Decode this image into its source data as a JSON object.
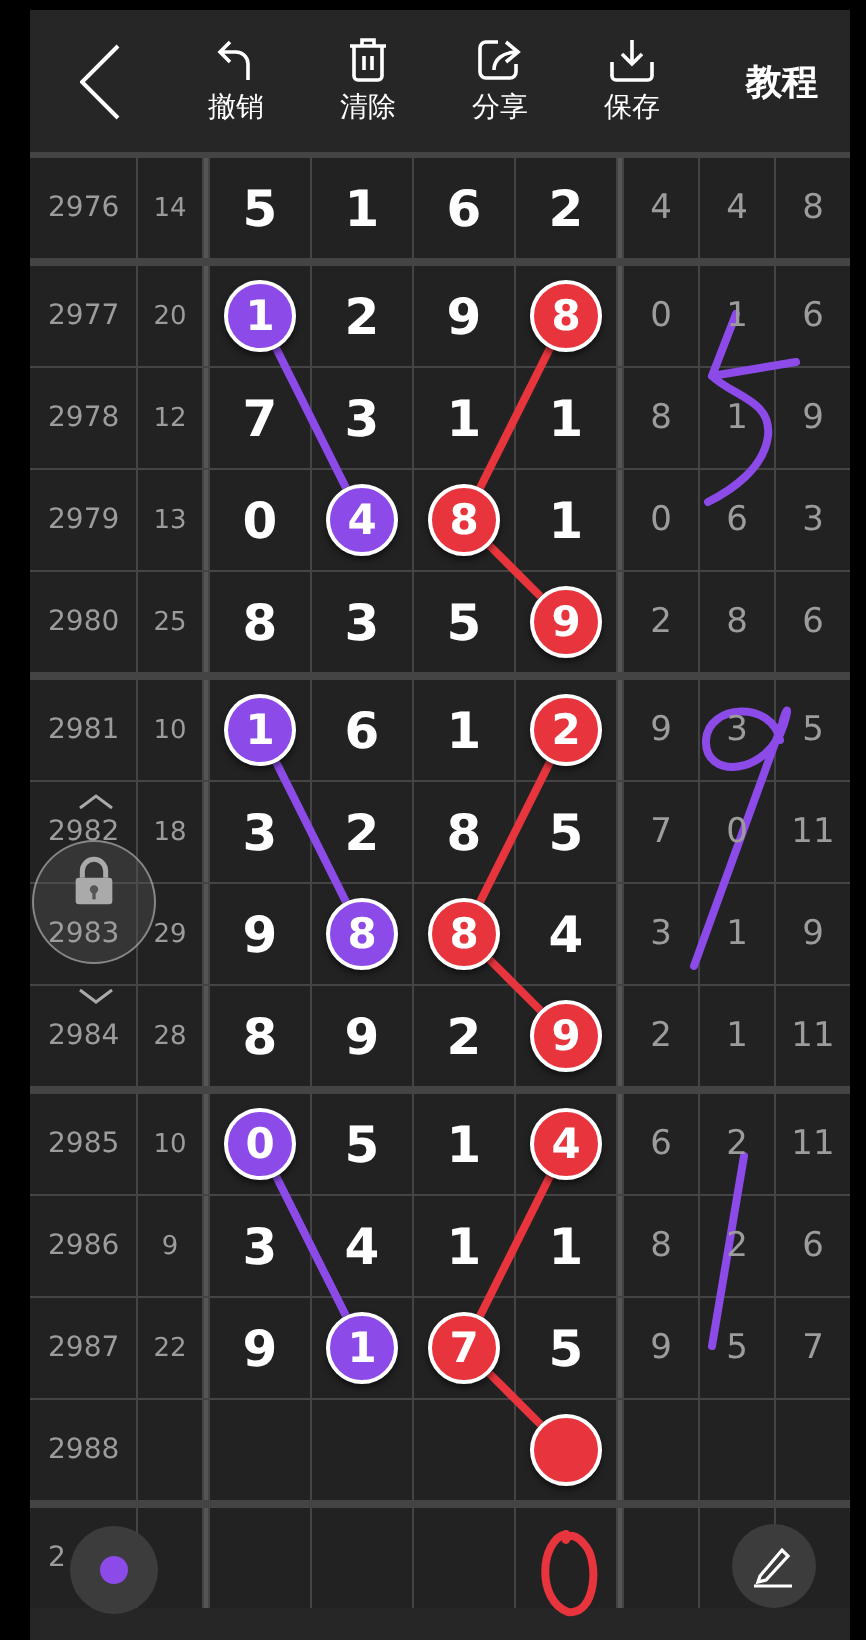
{
  "toolbar": {
    "actions": [
      {
        "kind": "undo",
        "label": "撤销"
      },
      {
        "kind": "clear",
        "label": "清除"
      },
      {
        "kind": "share",
        "label": "分享"
      },
      {
        "kind": "save",
        "label": "保存"
      }
    ],
    "tutorial": "教程"
  },
  "groups": [
    {
      "rows": [
        {
          "issue": "2976",
          "sum": "14",
          "digits": [
            {
              "kind": "plain",
              "value": "5"
            },
            {
              "kind": "plain",
              "value": "1"
            },
            {
              "kind": "plain",
              "value": "6"
            },
            {
              "kind": "plain",
              "value": "2"
            }
          ],
          "extras": [
            "4",
            "4",
            "8"
          ]
        }
      ]
    },
    {
      "rows": [
        {
          "issue": "2977",
          "sum": "20",
          "digits": [
            {
              "kind": "ball",
              "value": "1",
              "color": "#8c4ae8"
            },
            {
              "kind": "plain",
              "value": "2"
            },
            {
              "kind": "plain",
              "value": "9"
            },
            {
              "kind": "ball",
              "value": "8",
              "color": "#e8353d"
            }
          ],
          "extras": [
            "0",
            "1",
            "6"
          ]
        },
        {
          "issue": "2978",
          "sum": "12",
          "digits": [
            {
              "kind": "plain",
              "value": "7"
            },
            {
              "kind": "plain",
              "value": "3"
            },
            {
              "kind": "plain",
              "value": "1"
            },
            {
              "kind": "plain",
              "value": "1"
            }
          ],
          "extras": [
            "8",
            "1",
            "9"
          ]
        },
        {
          "issue": "2979",
          "sum": "13",
          "digits": [
            {
              "kind": "plain",
              "value": "0"
            },
            {
              "kind": "ball",
              "value": "4",
              "color": "#8c4ae8"
            },
            {
              "kind": "ball",
              "value": "8",
              "color": "#e8353d"
            },
            {
              "kind": "plain",
              "value": "1"
            }
          ],
          "extras": [
            "0",
            "6",
            "3"
          ]
        },
        {
          "issue": "2980",
          "sum": "25",
          "digits": [
            {
              "kind": "plain",
              "value": "8"
            },
            {
              "kind": "plain",
              "value": "3"
            },
            {
              "kind": "plain",
              "value": "5"
            },
            {
              "kind": "ball",
              "value": "9",
              "color": "#e8353d"
            }
          ],
          "extras": [
            "2",
            "8",
            "6"
          ]
        }
      ]
    },
    {
      "rows": [
        {
          "issue": "2981",
          "sum": "10",
          "digits": [
            {
              "kind": "ball",
              "value": "1",
              "color": "#8c4ae8"
            },
            {
              "kind": "plain",
              "value": "6"
            },
            {
              "kind": "plain",
              "value": "1"
            },
            {
              "kind": "ball",
              "value": "2",
              "color": "#e8353d"
            }
          ],
          "extras": [
            "9",
            "3",
            "5"
          ]
        },
        {
          "issue": "2982",
          "sum": "18",
          "digits": [
            {
              "kind": "plain",
              "value": "3"
            },
            {
              "kind": "plain",
              "value": "2"
            },
            {
              "kind": "plain",
              "value": "8"
            },
            {
              "kind": "plain",
              "value": "5"
            }
          ],
          "extras": [
            "7",
            "0",
            "11"
          ]
        },
        {
          "issue": "2983",
          "sum": "29",
          "digits": [
            {
              "kind": "plain",
              "value": "9"
            },
            {
              "kind": "ball",
              "value": "8",
              "color": "#8c4ae8"
            },
            {
              "kind": "ball",
              "value": "8",
              "color": "#e8353d"
            },
            {
              "kind": "plain",
              "value": "4"
            }
          ],
          "extras": [
            "3",
            "1",
            "9"
          ]
        },
        {
          "issue": "2984",
          "sum": "28",
          "digits": [
            {
              "kind": "plain",
              "value": "8"
            },
            {
              "kind": "plain",
              "value": "9"
            },
            {
              "kind": "plain",
              "value": "2"
            },
            {
              "kind": "ball",
              "value": "9",
              "color": "#e8353d"
            }
          ],
          "extras": [
            "2",
            "1",
            "11"
          ]
        }
      ]
    },
    {
      "rows": [
        {
          "issue": "2985",
          "sum": "10",
          "digits": [
            {
              "kind": "ball",
              "value": "0",
              "color": "#8c4ae8"
            },
            {
              "kind": "plain",
              "value": "5"
            },
            {
              "kind": "plain",
              "value": "1"
            },
            {
              "kind": "ball",
              "value": "4",
              "color": "#e8353d"
            }
          ],
          "extras": [
            "6",
            "2",
            "11"
          ]
        },
        {
          "issue": "2986",
          "sum": "9",
          "digits": [
            {
              "kind": "plain",
              "value": "3"
            },
            {
              "kind": "plain",
              "value": "4"
            },
            {
              "kind": "plain",
              "value": "1"
            },
            {
              "kind": "plain",
              "value": "1"
            }
          ],
          "extras": [
            "8",
            "2",
            "6"
          ]
        },
        {
          "issue": "2987",
          "sum": "22",
          "digits": [
            {
              "kind": "plain",
              "value": "9"
            },
            {
              "kind": "ball",
              "value": "1",
              "color": "#8c4ae8"
            },
            {
              "kind": "ball",
              "value": "7",
              "color": "#e8353d"
            },
            {
              "kind": "plain",
              "value": "5"
            }
          ],
          "extras": [
            "9",
            "5",
            "7"
          ]
        },
        {
          "issue": "2988",
          "digits": [
            {
              "kind": "blank"
            },
            {
              "kind": "blank"
            },
            {
              "kind": "blank"
            },
            {
              "kind": "ball",
              "color": "#e8353d"
            }
          ]
        }
      ]
    },
    {
      "rows": [
        {
          "issue": "2"
        }
      ]
    }
  ],
  "pen": {
    "color": "#8c4ae8"
  }
}
